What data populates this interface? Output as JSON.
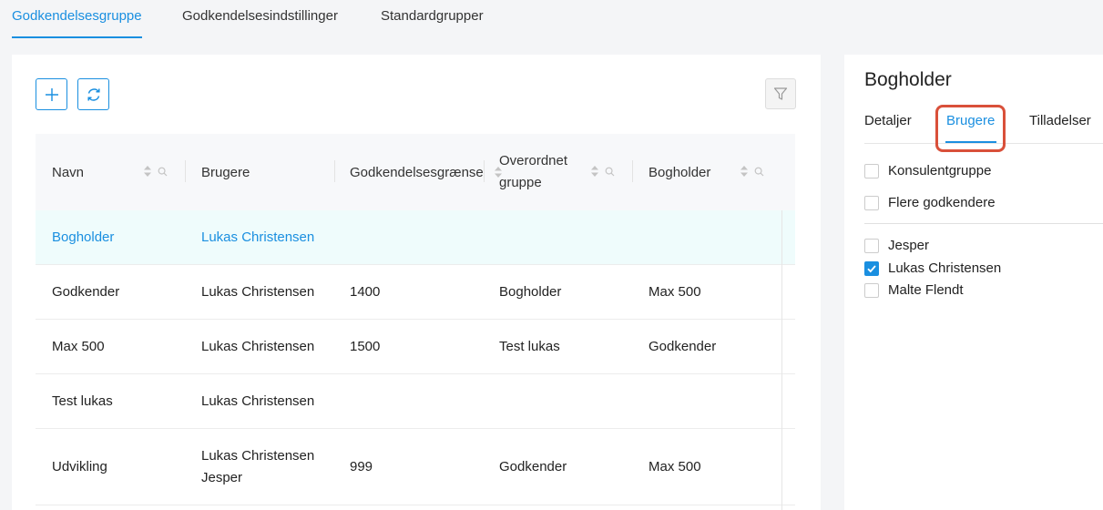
{
  "top_tabs": [
    {
      "label": "Godkendelsesgruppe",
      "active": true
    },
    {
      "label": "Godkendelsesindstillinger",
      "active": false
    },
    {
      "label": "Standardgrupper",
      "active": false
    }
  ],
  "toolbar": {
    "add_icon": "plus-icon",
    "refresh_icon": "refresh-icon",
    "filter_icon": "filter-icon"
  },
  "table": {
    "headers": {
      "name": "Navn",
      "users": "Brugere",
      "limit": "Godkendelsesgrænse",
      "parent_line1": "Overordnet",
      "parent_line2": "gruppe",
      "bookkeeper": "Bogholder"
    },
    "rows": [
      {
        "name": "Bogholder",
        "users": "Lukas Christensen",
        "users2": "",
        "limit": "",
        "parent": "",
        "bookkeeper": ""
      },
      {
        "name": "Godkender",
        "users": "Lukas Christensen",
        "users2": "",
        "limit": "1400",
        "parent": "Bogholder",
        "bookkeeper": "Max 500"
      },
      {
        "name": "Max 500",
        "users": "Lukas Christensen",
        "users2": "",
        "limit": "1500",
        "parent": "Test lukas",
        "bookkeeper": "Godkender"
      },
      {
        "name": "Test lukas",
        "users": "Lukas Christensen",
        "users2": "",
        "limit": "",
        "parent": "",
        "bookkeeper": ""
      },
      {
        "name": "Udvikling",
        "users": "Lukas Christensen",
        "users2": "Jesper",
        "limit": "999",
        "parent": "Godkender",
        "bookkeeper": "Max 500"
      }
    ]
  },
  "details": {
    "title": "Bogholder",
    "tabs": [
      {
        "label": "Detaljer",
        "active": false
      },
      {
        "label": "Brugere",
        "active": true
      },
      {
        "label": "Tilladelser",
        "active": false
      }
    ],
    "options": [
      {
        "label": "Konsulentgruppe",
        "checked": false
      },
      {
        "label": "Flere godkendere",
        "checked": false
      }
    ],
    "users": [
      {
        "label": "Jesper",
        "checked": false
      },
      {
        "label": "Lukas Christensen",
        "checked": true
      },
      {
        "label": "Malte Flendt",
        "checked": false
      }
    ]
  },
  "colors": {
    "accent": "#1a8fe0",
    "highlight": "#d9503a",
    "selected_row": "#effcfc"
  }
}
